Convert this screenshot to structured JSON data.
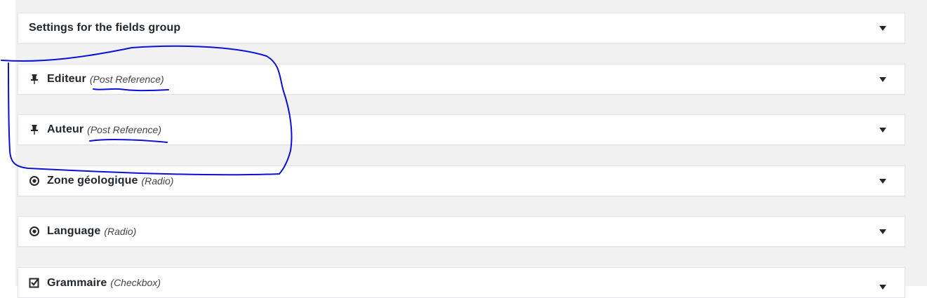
{
  "panels": [
    {
      "title": "Settings for the fields group",
      "type": "",
      "icon": ""
    },
    {
      "title": "Editeur",
      "type": "(Post Reference)",
      "icon": "pin-icon"
    },
    {
      "title": "Auteur",
      "type": "(Post Reference)",
      "icon": "pin-icon"
    },
    {
      "title": "Zone géologique",
      "type": "(Radio)",
      "icon": "radio-icon"
    },
    {
      "title": "Language",
      "type": "(Radio)",
      "icon": "radio-icon"
    },
    {
      "title": "Grammaire",
      "type": "(Checkbox)",
      "icon": "checkbox-icon"
    }
  ],
  "colors": {
    "background": "#f1f1f1",
    "panel": "#ffffff",
    "text": "#23282d",
    "annotation_ink": "#0a10d4"
  }
}
